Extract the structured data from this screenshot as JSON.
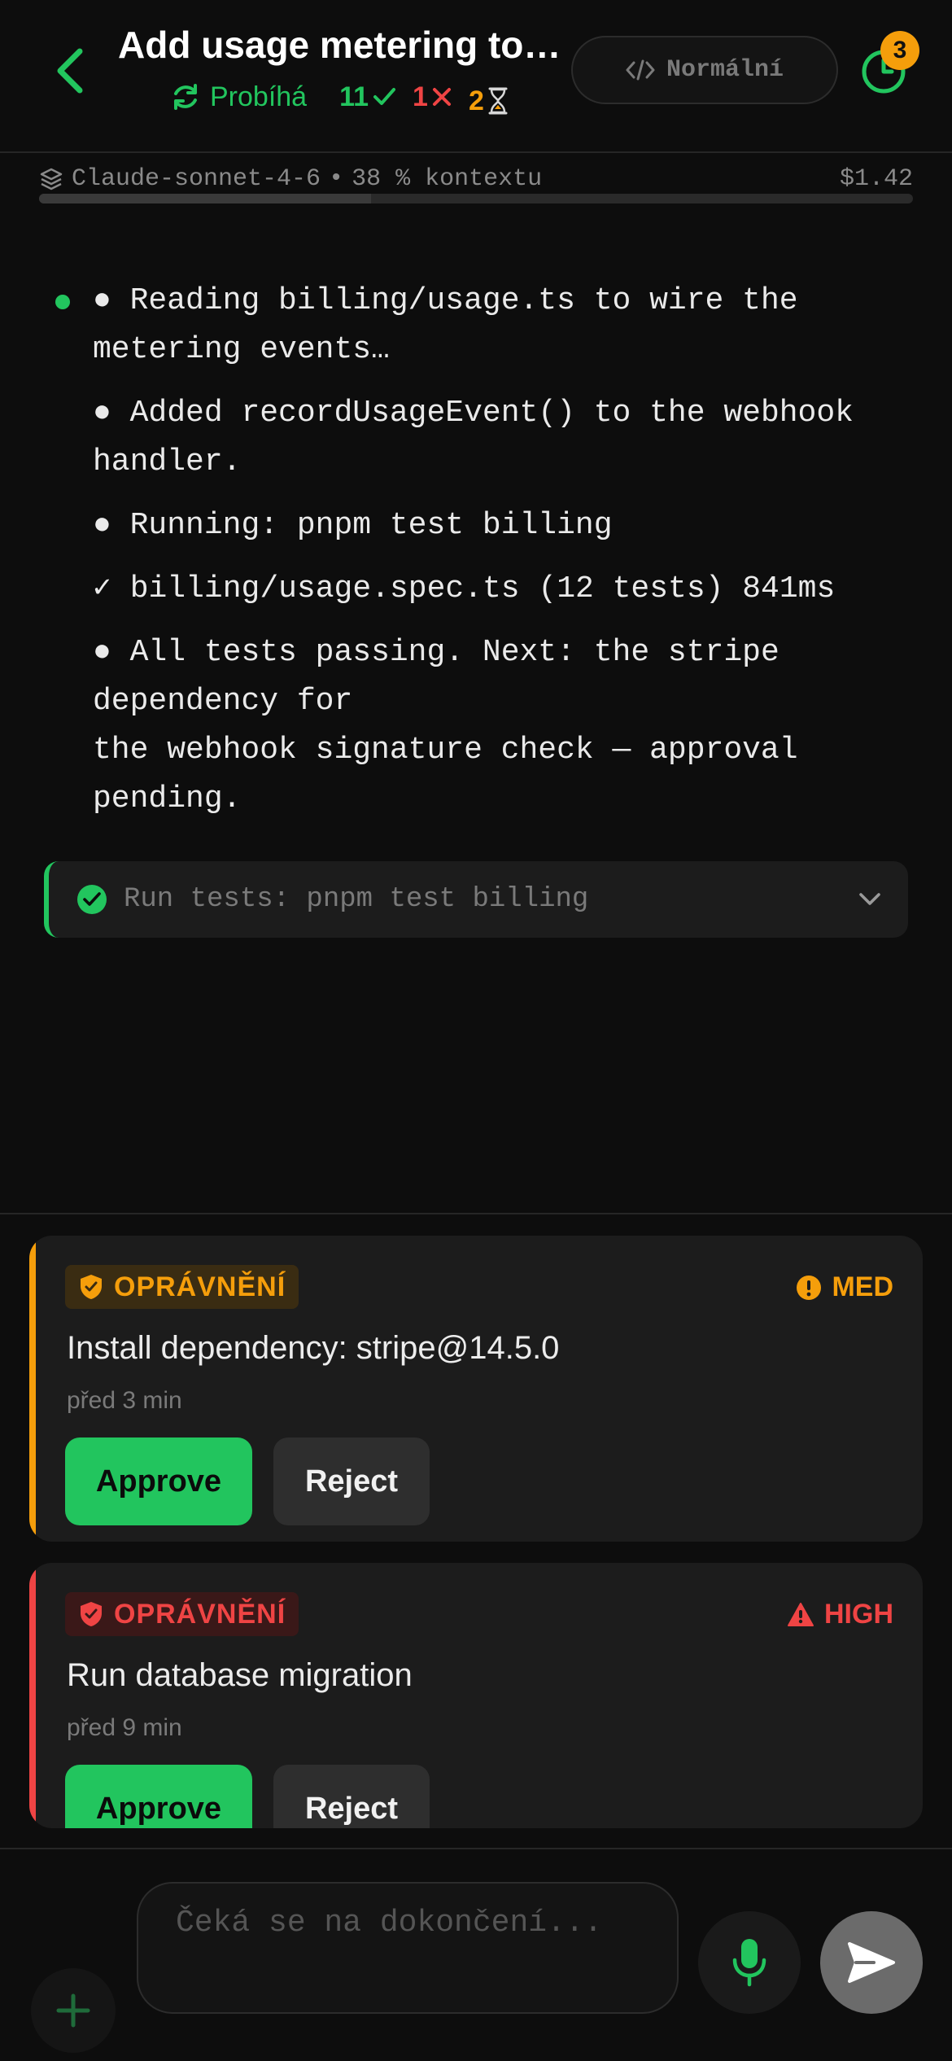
{
  "header": {
    "title": "Add usage metering to…",
    "status": "Probíhá",
    "pass_count": "11",
    "fail_count": "1",
    "pending_count": "2",
    "mode_label": "Normální",
    "history_badge": "3"
  },
  "model_bar": {
    "model": "Claude-sonnet-4-6",
    "separator": "•",
    "context": "38 % kontextu",
    "cost": "$1.42",
    "context_fraction": 0.38
  },
  "log": {
    "lines": [
      {
        "marker": "●",
        "text": "Reading billing/usage.ts to wire the metering events…"
      },
      {
        "marker": "●",
        "text": "Added recordUsageEvent() to the webhook handler."
      },
      {
        "marker": "●",
        "text": "Running: pnpm test billing"
      },
      {
        "marker": "✓",
        "text": "billing/usage.spec.ts (12 tests) 841ms"
      },
      {
        "marker": "●",
        "text": "All tests passing. Next: the stripe dependency for\nthe webhook signature check — approval pending."
      }
    ]
  },
  "tool_card": {
    "label": "Run tests: pnpm test billing"
  },
  "permissions": [
    {
      "tag": "OPRÁVNĚNÍ",
      "risk": "MED",
      "title": "Install dependency: stripe@14.5.0",
      "time": "před 3 min",
      "approve_label": "Approve",
      "reject_label": "Reject",
      "accent": "#f59e0b"
    },
    {
      "tag": "OPRÁVNĚNÍ",
      "risk": "HIGH",
      "title": "Run database migration",
      "time": "před 9 min",
      "approve_label": "Approve",
      "reject_label": "Reject",
      "accent": "#ef4444"
    }
  ],
  "composer": {
    "placeholder": "Čeká se na dokončení..."
  },
  "colors": {
    "success": "#22c55e",
    "danger": "#ef4444",
    "warning": "#f59e0b",
    "background": "#0d0d0d",
    "card": "#1c1c1c"
  },
  "icons": [
    "chevron-left-icon",
    "refresh-icon",
    "check-icon",
    "close-icon",
    "hourglass-icon",
    "code-icon",
    "clock-icon",
    "layers-icon",
    "check-circle-icon",
    "chevron-down-icon",
    "shield-icon",
    "alert-circle-icon",
    "warning-triangle-icon",
    "plus-icon",
    "mic-icon",
    "send-icon"
  ]
}
